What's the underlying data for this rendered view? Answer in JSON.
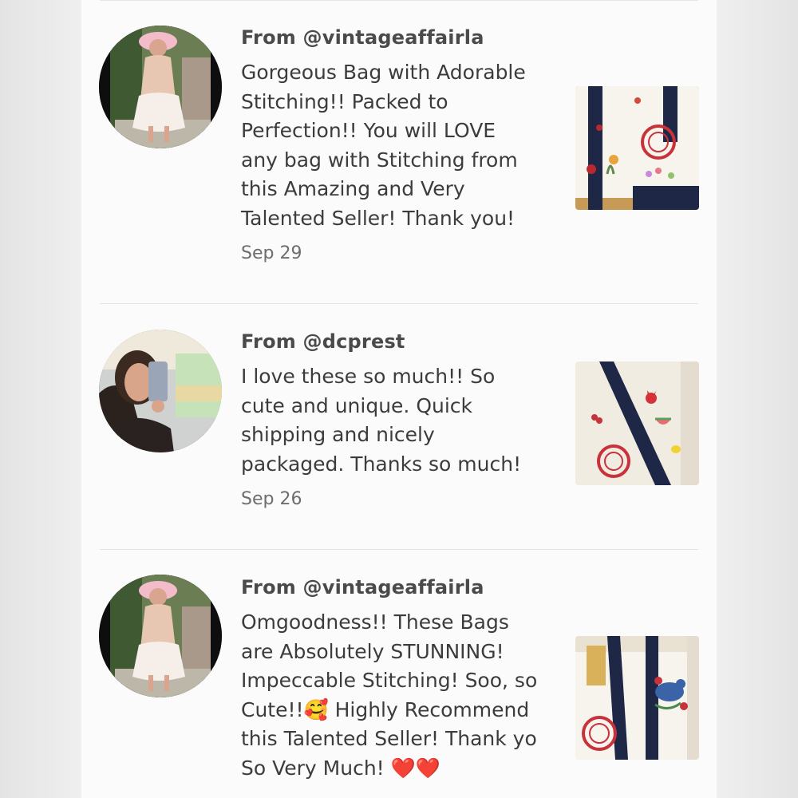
{
  "reviews": [
    {
      "from": "From @vintageaffairla",
      "text": "Gorgeous Bag with Adorable\nStitching!! Packed to\nPerfection!! You will LOVE\nany bag with Stitching from\nthis Amazing and Very\nTalented Seller! Thank you!",
      "date": "Sep 29",
      "avatar_icon": "user-avatar-photo",
      "thumb_icon": "tote-bag-photo-flowers"
    },
    {
      "from": "From @dcprest",
      "text": "I love these so much!! So\ncute and unique. Quick\nshipping and nicely\npackaged. Thanks so much!",
      "date": "Sep 26",
      "avatar_icon": "user-avatar-photo",
      "thumb_icon": "tote-bag-photo-fruits"
    },
    {
      "from": "From @vintageaffairla",
      "text": "Omgoodness!! These Bags\nare Absolutely STUNNING!\nImpeccable Stitching! Soo, so\nCute!!🥰 Highly Recommend\nthis Talented Seller! Thank yo\nSo Very Much! ❤️❤️",
      "date": "",
      "avatar_icon": "user-avatar-photo",
      "thumb_icon": "tote-bag-photo-bird"
    }
  ],
  "colors": {
    "panel_bg": "#fbfbfb",
    "text_primary": "#3c3c3c",
    "text_secondary": "#6d6d6d",
    "tote_navy": "#1f2746",
    "tote_red": "#c8323a"
  }
}
